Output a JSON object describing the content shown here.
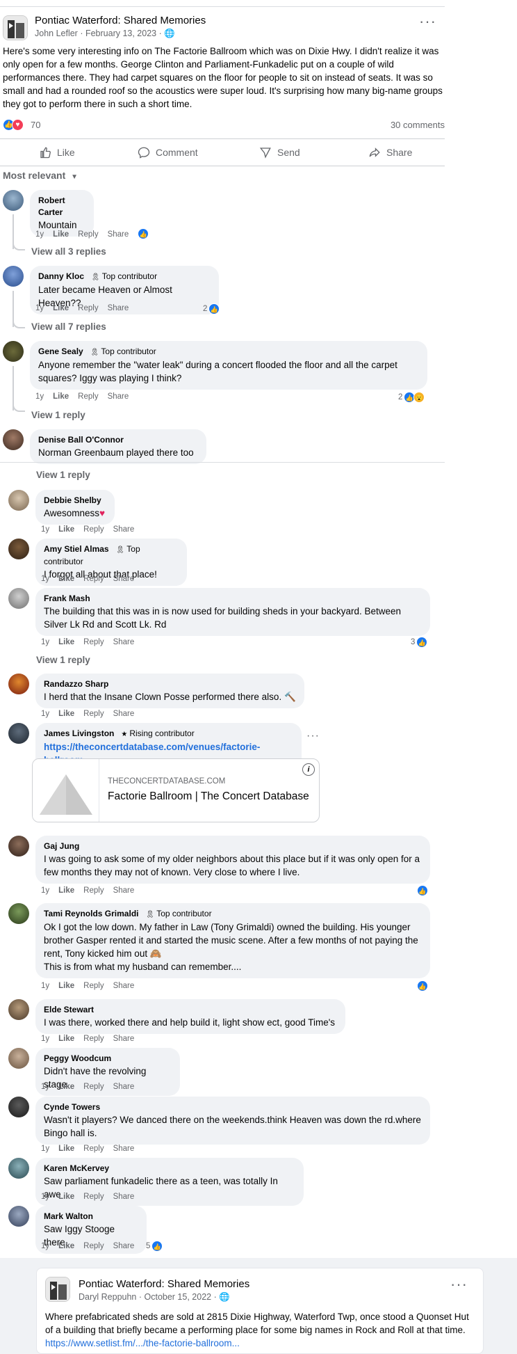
{
  "post": {
    "group_name": "Pontiac Waterford: Shared Memories",
    "author": "John Lefler",
    "date": "February 13, 2023",
    "more": "···",
    "body": "Here's some very interesting info on The Factorie Ballroom which was on Dixie Hwy. I didn't realize it was only open for a few months. George Clinton and Parliament-Funkadelic put on a couple of wild performances there. They had carpet squares on the floor for people to sit on instead of seats. It was so small and had a rounded roof so the acoustics were super loud. It's surprising how many big-name groups they got to perform there in such a short time.",
    "reaction_count": "70",
    "comments_count": "30 comments"
  },
  "actions": {
    "like": "Like",
    "comment": "Comment",
    "send": "Send",
    "share": "Share"
  },
  "sort_label": "Most relevant",
  "comment_actions": {
    "time": "1y",
    "like": "Like",
    "reply": "Reply",
    "share": "Share"
  },
  "comments": [
    {
      "name": "Robert Carter",
      "text": "Mountain"
    },
    {
      "name": "Danny Kloc",
      "badge": "Top contributor",
      "text": "Later became Heaven or Almost Heaven??",
      "likes": "2"
    },
    {
      "name": "Gene Sealy",
      "badge": "Top contributor",
      "text": "Anyone remember the \"water leak\" during a concert flooded the floor and all the carpet squares? Iggy was playing I think?",
      "likes": "2"
    },
    {
      "name": "Denise Ball O'Connor",
      "text": "Norman Greenbaum played there too"
    },
    {
      "name": "Debbie Shelby",
      "text": "Awesomness"
    },
    {
      "name": "Amy Stiel Almas",
      "badge": "Top contributor",
      "text": "I forgot all about that place!"
    },
    {
      "name": "Frank Mash",
      "text": "The building that this was in is now used for building sheds in your backyard. Between Silver Lk Rd and Scott Lk. Rd",
      "likes": "3"
    },
    {
      "name": "Randazzo Sharp",
      "text": "I herd that the Insane Clown Posse performed there also."
    },
    {
      "name": "James Livingston",
      "badge": "Rising contributor",
      "text": "https://theconcertdatabase.com/venues/factorie-ballroom"
    },
    {
      "name": "Gaj Jung",
      "text": "I was going to ask some of my older neighbors about this place but if it was only open for a few months they may not of known. Very close to where I live."
    },
    {
      "name": "Tami Reynolds Grimaldi",
      "badge": "Top contributor",
      "text": "Ok I got the low down. My father in Law (Tony Grimaldi) owned the building. His younger brother Gasper rented it and started the music scene. After a few months of not paying the rent, Tony kicked him out",
      "text2": "This is from what my husband can remember...."
    },
    {
      "name": "Elde Stewart",
      "text": "I was there, worked there and help build it, light show ect, good Time's"
    },
    {
      "name": "Peggy Woodcum",
      "text": "Didn't have the revolving stage"
    },
    {
      "name": "Cynde Towers",
      "text": "Wasn't it players? We danced there on the weekends.think Heaven was down the rd.where Bingo hall is."
    },
    {
      "name": "Karen McKervey",
      "text": "Saw parliament funkadelic there as a teen, was totally In awe"
    },
    {
      "name": "Mark Walton",
      "text": "Saw Iggy Stooge there.",
      "likes": "5"
    }
  ],
  "replies": {
    "r1": "View all 3 replies",
    "r2": "View all 7 replies",
    "r3": "View 1 reply",
    "r4": "View 1 reply",
    "r5": "View 1 reply"
  },
  "link_preview": {
    "domain": "THECONCERTDATABASE.COM",
    "title": "Factorie Ballroom | The Concert Database"
  },
  "post2": {
    "group_name": "Pontiac Waterford: Shared Memories",
    "author": "Daryl Reppuhn",
    "date": "October 15, 2022",
    "body": "Where prefabricated sheds are sold at 2815 Dixie Highway, Waterford Twp, once stood a  Quonset Hut of a building that briefly became a performing place for some big names in Rock and Roll at that time.",
    "link": "https://www.setlist.fm/.../the-factorie-ballroom..."
  },
  "colors": {
    "accent": "#216fdb",
    "like_blue": "#1877f2",
    "love_red": "#f33e58",
    "bubble": "#f0f2f5"
  }
}
